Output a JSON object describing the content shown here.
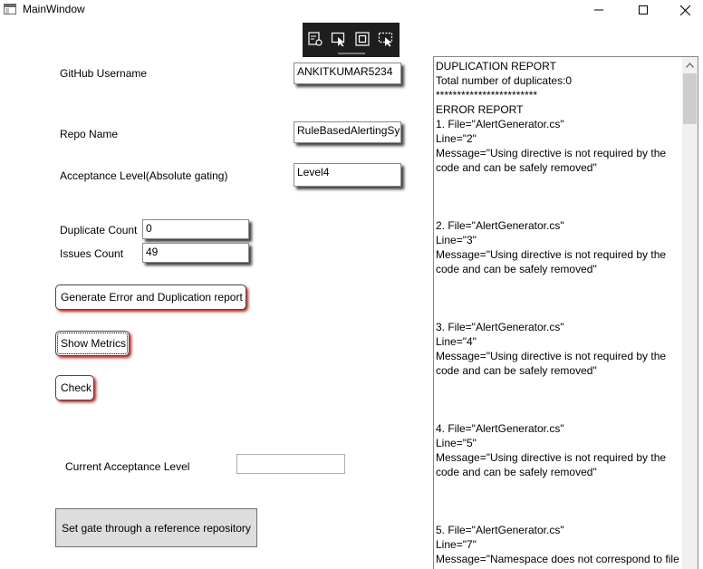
{
  "window": {
    "title": "MainWindow",
    "minimize_icon": "minimize-icon",
    "maximize_icon": "maximize-icon",
    "close_icon": "close-icon"
  },
  "debug_toolbar": {
    "icons": [
      "live-visual-tree-icon",
      "select-element-icon",
      "display-layout-adorners-icon",
      "track-focused-element-icon"
    ]
  },
  "form": {
    "username_label": "GitHub Username",
    "username_value": "ANKITKUMAR5234",
    "repo_label": "Repo Name",
    "repo_value": "RuleBasedAlertingSys",
    "acceptance_label": "Acceptance Level(Absolute gating)",
    "acceptance_value": "Level4",
    "duplicate_label": "Duplicate Count",
    "duplicate_value": "0",
    "issues_label": "Issues Count",
    "issues_value": "49",
    "generate_button": "Generate Error and Duplication report",
    "metrics_button": "Show Metrics",
    "check_button": "Check",
    "current_level_label": "Current Acceptance Level",
    "current_level_value": "",
    "set_gate_button": "Set gate through a reference repository"
  },
  "report": {
    "lines": [
      "DUPLICATION REPORT",
      "Total number of duplicates:0",
      "************************",
      "ERROR REPORT",
      "1.  File=\"AlertGenerator.cs\"",
      "Line=\"2\"",
      "Message=\"Using directive is not required by the",
      "code and can be safely removed\"",
      "",
      "",
      "",
      "2.  File=\"AlertGenerator.cs\"",
      "Line=\"3\"",
      "Message=\"Using directive is not required by the",
      "code and can be safely removed\"",
      "",
      "",
      "",
      "3.  File=\"AlertGenerator.cs\"",
      "Line=\"4\"",
      "Message=\"Using directive is not required by the",
      "code and can be safely removed\"",
      "",
      "",
      "",
      "4.  File=\"AlertGenerator.cs\"",
      "Line=\"5\"",
      "Message=\"Using directive is not required by the",
      "code and can be safely removed\"",
      "",
      "",
      "",
      "5.  File=\"AlertGenerator.cs\"",
      "Line=\"7\"",
      "Message=\"Namespace does not correspond to file"
    ]
  }
}
